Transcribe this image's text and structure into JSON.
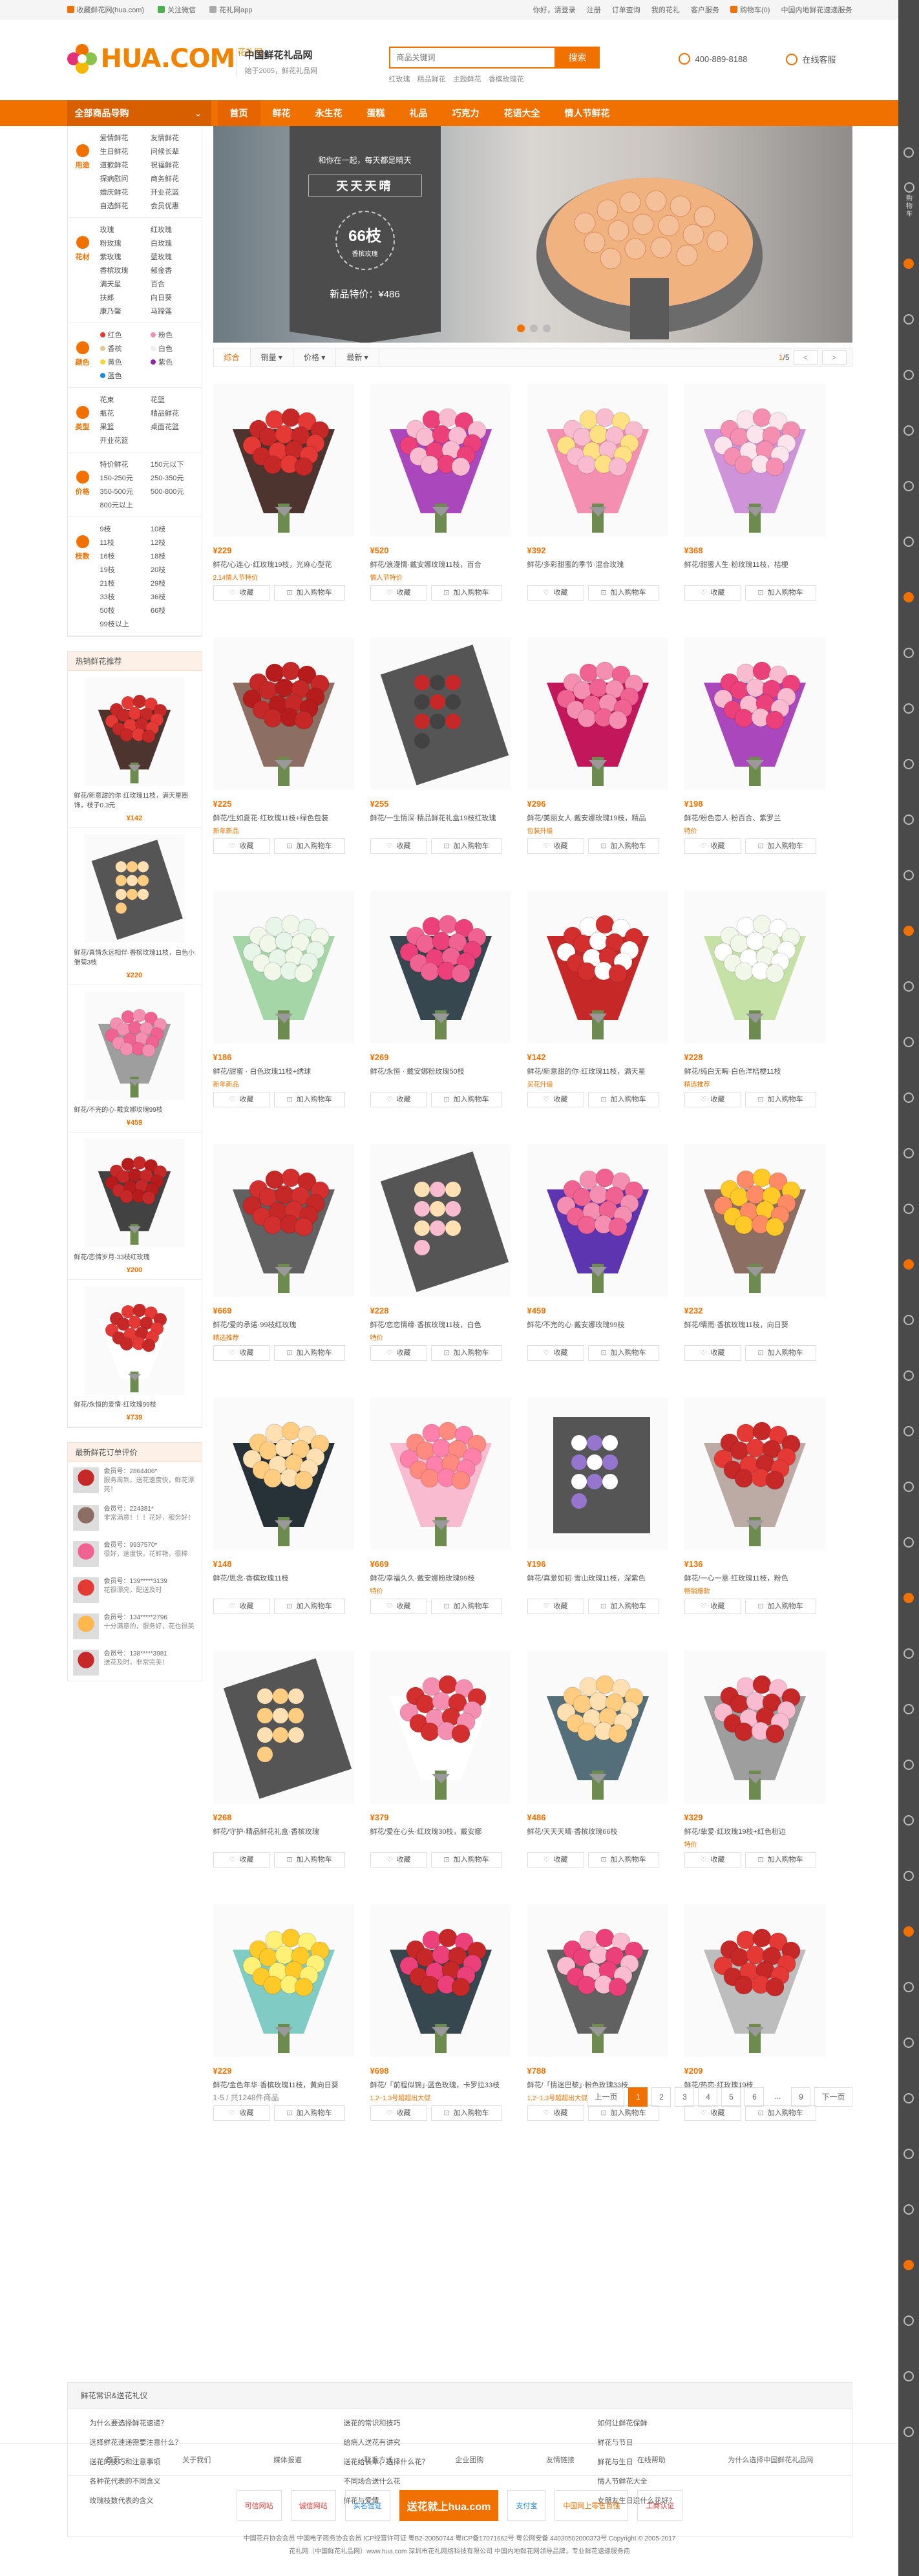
{
  "topbar": {
    "left": [
      "收藏鲜花网(hua.com)",
      "关注微信",
      "花礼网app"
    ],
    "right": [
      "你好，请登录",
      "注册",
      "订单查询",
      "我的花礼",
      "客户服务",
      "购物车(0)",
      "中国内地鲜花速递服务"
    ]
  },
  "header": {
    "logo": "HUA.COM",
    "logo_cn": "花礼网",
    "slogan_a": "中国鲜花礼品网",
    "slogan_b": "始于2005，鲜花礼品网",
    "search_placeholder": "商品关键词",
    "search_btn": "搜索",
    "hot": [
      "红玫瑰",
      "精品鲜花",
      "主题鲜花",
      "香槟玫瑰花"
    ],
    "phone": "400-889-8188",
    "chat": "在线客服"
  },
  "nav": {
    "cat": "全部商品导购",
    "items": [
      "首页",
      "鲜花",
      "永生花",
      "蛋糕",
      "礼品",
      "巧克力",
      "花语大全",
      "情人节鲜花"
    ]
  },
  "side": {
    "rows": [
      {
        "label": "用途",
        "items": [
          "爱情鲜花",
          "友情鲜花",
          "生日鲜花",
          "问候长辈",
          "道歉鲜花",
          "祝福鲜花",
          "探病慰问",
          "商务鲜花",
          "婚庆鲜花",
          "开业花篮",
          "自选鲜花",
          "会员优惠"
        ]
      },
      {
        "label": "花材",
        "items": [
          "玫瑰",
          "红玫瑰",
          "粉玫瑰",
          "白玫瑰",
          "紫玫瑰",
          "蓝玫瑰",
          "香槟玫瑰",
          "郁金香",
          "满天星",
          "百合",
          "扶郎",
          "向日葵",
          "康乃馨",
          "马蹄莲"
        ]
      },
      {
        "label": "颜色",
        "items": [
          "红色",
          "粉色",
          "香槟",
          "白色",
          "黄色",
          "紫色",
          "蓝色"
        ]
      },
      {
        "label": "类型",
        "items": [
          "花束",
          "花篮",
          "瓶花",
          "精品鲜花",
          "果篮",
          "桌面花篮",
          "开业花篮"
        ]
      },
      {
        "label": "价格",
        "items": [
          "特价鲜花",
          "150元以下",
          "150-250元",
          "250-350元",
          "350-500元",
          "500-800元",
          "800元以上"
        ]
      },
      {
        "label": "枝数",
        "items": [
          "9枝",
          "10枝",
          "11枝",
          "12枝",
          "16枝",
          "18枝",
          "19枝",
          "20枝",
          "21枝",
          "29枝",
          "33枝",
          "36枝",
          "50枝",
          "66枝",
          "99枝以上"
        ]
      }
    ],
    "hot_title": "热销鲜花推荐",
    "hot": [
      {
        "name": "鲜花/新意甜的你·红玫瑰11枝，满天星圈饰，枝子0.3元",
        "price": "¥142"
      },
      {
        "name": "鲜花/真情永远相伴·香槟玫瑰11枝，白色小雏菊3枝",
        "price": "¥220"
      },
      {
        "name": "鲜花/不完的心·戴安娜玫瑰99枝",
        "price": "¥459"
      },
      {
        "name": "鲜花/恋情岁月·33枝红玫瑰",
        "price": "¥200"
      },
      {
        "name": "鲜花/永恒的爱情·红玫瑰99枝",
        "price": "¥739"
      }
    ],
    "review_title": "最新鲜花订单评价",
    "reviews": [
      {
        "user": "会员号：2864406*",
        "text": "服务周到，送花速度快，鲜花漂亮！"
      },
      {
        "user": "会员号：224381*",
        "text": "非常满意！！！花好，服务好！"
      },
      {
        "user": "会员号：9937570*",
        "text": "很好，速度快，花鲜艳，很棒"
      },
      {
        "user": "会员号：139*****3139",
        "text": "花很漂亮，配送及时"
      },
      {
        "user": "会员号：134*****2796",
        "text": "十分满意的，服务好，花也很美"
      },
      {
        "user": "会员号：138*****3981",
        "text": "送花及时，非常完美！"
      }
    ]
  },
  "banner": {
    "t1": "和你在一起，每天都是晴天",
    "t2": "天天天晴",
    "badge_n": "66枝",
    "badge_t": "香槟玫瑰",
    "t3": "新品特价：¥486"
  },
  "sort": {
    "items": [
      "综合",
      "销量 ▾",
      "价格 ▾",
      "最新 ▾"
    ],
    "page": "1",
    "pages": "/5",
    "prev": "<",
    "next": ">"
  },
  "cards": [
    {
      "price": "¥229",
      "name": "鲜花/心连心·红玫瑰19枝，光麻心型花",
      "tag": "2.14情人节特价"
    },
    {
      "price": "¥520",
      "name": "鲜花/浪漫情·戴安娜玫瑰11枝，百合",
      "tag": "情人节特价"
    },
    {
      "price": "¥392",
      "name": "鲜花/多彩甜蜜的季节·混合玫瑰",
      "tag": ""
    },
    {
      "price": "¥368",
      "name": "鲜花/甜蜜人生·粉玫瑰11枝，桔梗",
      "tag": ""
    },
    {
      "price": "¥225",
      "name": "鲜花/生如夏花·红玫瑰11枝+绿色包装",
      "tag": "新年新品"
    },
    {
      "price": "¥255",
      "name": "鲜花/一生情深·精品鲜花礼盒19枝红玫瑰",
      "tag": ""
    },
    {
      "price": "¥296",
      "name": "鲜花/美丽女人·戴安娜玫瑰19枝，精品",
      "tag": "包装升级"
    },
    {
      "price": "¥198",
      "name": "鲜花/粉色恋人·粉百合、紫罗兰",
      "tag": "特价"
    },
    {
      "price": "¥186",
      "name": "鲜花/甜蜜 · 白色玫瑰11枝+绣球",
      "tag": "新年新品"
    },
    {
      "price": "¥269",
      "name": "鲜花/永恒 · 戴安娜粉玫瑰50枝",
      "tag": ""
    },
    {
      "price": "¥142",
      "name": "鲜花/新意甜的你·红玫瑰11枝，满天星",
      "tag": "买花升级"
    },
    {
      "price": "¥228",
      "name": "鲜花/纯白无暇·白色洋桔梗11枝",
      "tag": "精选推荐"
    },
    {
      "price": "¥669",
      "name": "鲜花/爱的承诺·99枝红玫瑰",
      "tag": "精选推荐"
    },
    {
      "price": "¥228",
      "name": "鲜花/恋恋情缘·香槟玫瑰11枝，白色",
      "tag": "特价"
    },
    {
      "price": "¥459",
      "name": "鲜花/不完的心·戴安娜玫瑰99枝",
      "tag": ""
    },
    {
      "price": "¥232",
      "name": "鲜花/睛雨·香槟玫瑰11枝，向日葵",
      "tag": ""
    },
    {
      "price": "¥148",
      "name": "鲜花/思念·香槟玫瑰11枝",
      "tag": ""
    },
    {
      "price": "¥669",
      "name": "鲜花/幸福久久·戴安娜粉玫瑰99枝",
      "tag": "特价"
    },
    {
      "price": "¥196",
      "name": "鲜花/真爱如初·雪山玫瑰11枝，深紫色",
      "tag": ""
    },
    {
      "price": "¥136",
      "name": "鲜花/一心一意·红玫瑰11枝，粉色",
      "tag": "畅销爆款"
    },
    {
      "price": "¥268",
      "name": "鲜花/守护·精品鲜花礼盒·香槟玫瑰",
      "tag": ""
    },
    {
      "price": "¥379",
      "name": "鲜花/爱在心头·红玫瑰30枝，戴安娜",
      "tag": ""
    },
    {
      "price": "¥486",
      "name": "鲜花/天天天晴·香槟玫瑰66枝",
      "tag": ""
    },
    {
      "price": "¥329",
      "name": "鲜花/挚爱·红玫瑰19枝+红色粉边",
      "tag": "特价"
    },
    {
      "price": "¥229",
      "name": "鲜花/金色年华·香槟玫瑰11枝，黄向日葵",
      "tag": ""
    },
    {
      "price": "¥698",
      "name": "鲜花/「前程似锦」·蓝色玫瑰，卡罗拉33枝",
      "tag": "1.2~1.3号超超出大促"
    },
    {
      "price": "¥788",
      "name": "鲜花/「情迷巴黎」·粉色玫瑰33枝",
      "tag": "1.2~1.3号超超出大促"
    },
    {
      "price": "¥209",
      "name": "鲜花/热恋·红玫瑰19枝",
      "tag": ""
    }
  ],
  "card_btns": {
    "fav": "收藏",
    "cart": "加入购物车"
  },
  "pagination": {
    "summary": "1-5 / 共1248件商品",
    "prev": "上一页",
    "pages": [
      "1",
      "2",
      "3",
      "4",
      "5",
      "6",
      "...",
      "9"
    ],
    "next": "下一页"
  },
  "faq": {
    "title": "鲜花常识&送花礼仪",
    "cols": [
      [
        "为什么要选择鲜花速递？",
        "选择鲜花速递需要注意什么？",
        "送花的技巧和注意事项",
        "各种花代表的不同含义",
        "玫瑰枝数代表的含义"
      ],
      [
        "送花的常识和技巧",
        "给病人送花有讲究",
        "送花给长辈，选择什么花？",
        "不同场合送什么花",
        "鲜花与爱情"
      ],
      [
        "如何让鲜花保鲜",
        "鲜花与节日",
        "鲜花与生日",
        "情人节鲜花大全",
        "女朋友生日送什么花好？"
      ]
    ]
  },
  "footer": {
    "links": [
      "首页",
      "关于我们",
      "媒体报道",
      "联系方式",
      "企业团购",
      "友情链接",
      "在线帮助",
      "为什么选择中国鲜花礼品网"
    ],
    "badges": [
      "可信网站",
      "诚信网站",
      "实名验证",
      "送花就上hua.com",
      "支付宝",
      "中国网上零售百强",
      "工商认证"
    ],
    "copy1": "中国花卉协会会员  中国电子商务协会会员  ICP经营许可证  粤B2-20050744  粤ICP备17071662号  粤公网安备 44030502000373号  Copyright © 2005-2017",
    "copy2": "花礼网（中国鲜花礼品网）www.hua.com 深圳市花礼网络科技有限公司 中国内地鲜花网领导品牌，专业鲜花速递服务商"
  },
  "rail": {
    "labels": [
      "购物车"
    ]
  },
  "colors": {
    "brand": "#f07000",
    "nav": "#f07000"
  }
}
